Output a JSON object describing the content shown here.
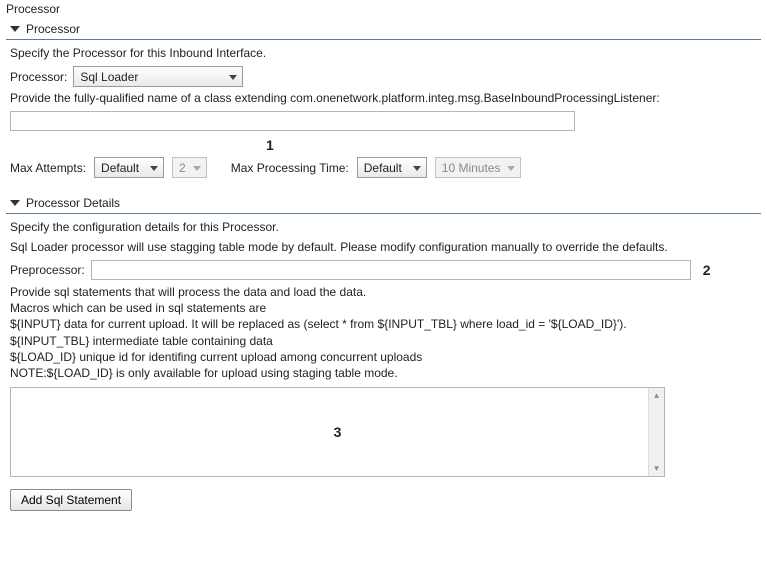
{
  "title": "Processor",
  "section_processor": {
    "header": "Processor",
    "intro": "Specify the Processor for this Inbound Interface.",
    "processor_label": "Processor:",
    "processor_value": "Sql Loader",
    "listener_help": "Provide the fully-qualified name of a class extending com.onenetwork.platform.integ.msg.BaseInboundProcessingListener:",
    "listener_value": "",
    "callout1": "1",
    "max_attempts_label": "Max Attempts:",
    "max_attempts_value": "Default",
    "max_attempts_num": "2",
    "max_proc_label": "Max Processing Time:",
    "max_proc_value": "Default",
    "max_proc_dur": "10 Minutes"
  },
  "section_details": {
    "header": "Processor Details",
    "intro": "Specify the configuration details for this Processor.",
    "note": "Sql Loader processor will use stagging table mode by default. Please modify configuration manually to override the defaults.",
    "preprocessor_label": "Preprocessor:",
    "preprocessor_value": "",
    "callout2": "2",
    "help_block": "Provide sql statements that will process the data and load the data.\nMacros which can be used in sql statements are\n${INPUT} data for current upload. It will be replaced as (select * from ${INPUT_TBL} where load_id = '${LOAD_ID}').\n${INPUT_TBL} intermediate table containing data\n${LOAD_ID} unique id for identifing current upload among concurrent uploads\nNOTE:${LOAD_ID} is only available for upload using staging table mode.",
    "callout3": "3",
    "add_stmt_label": "Add Sql Statement"
  }
}
